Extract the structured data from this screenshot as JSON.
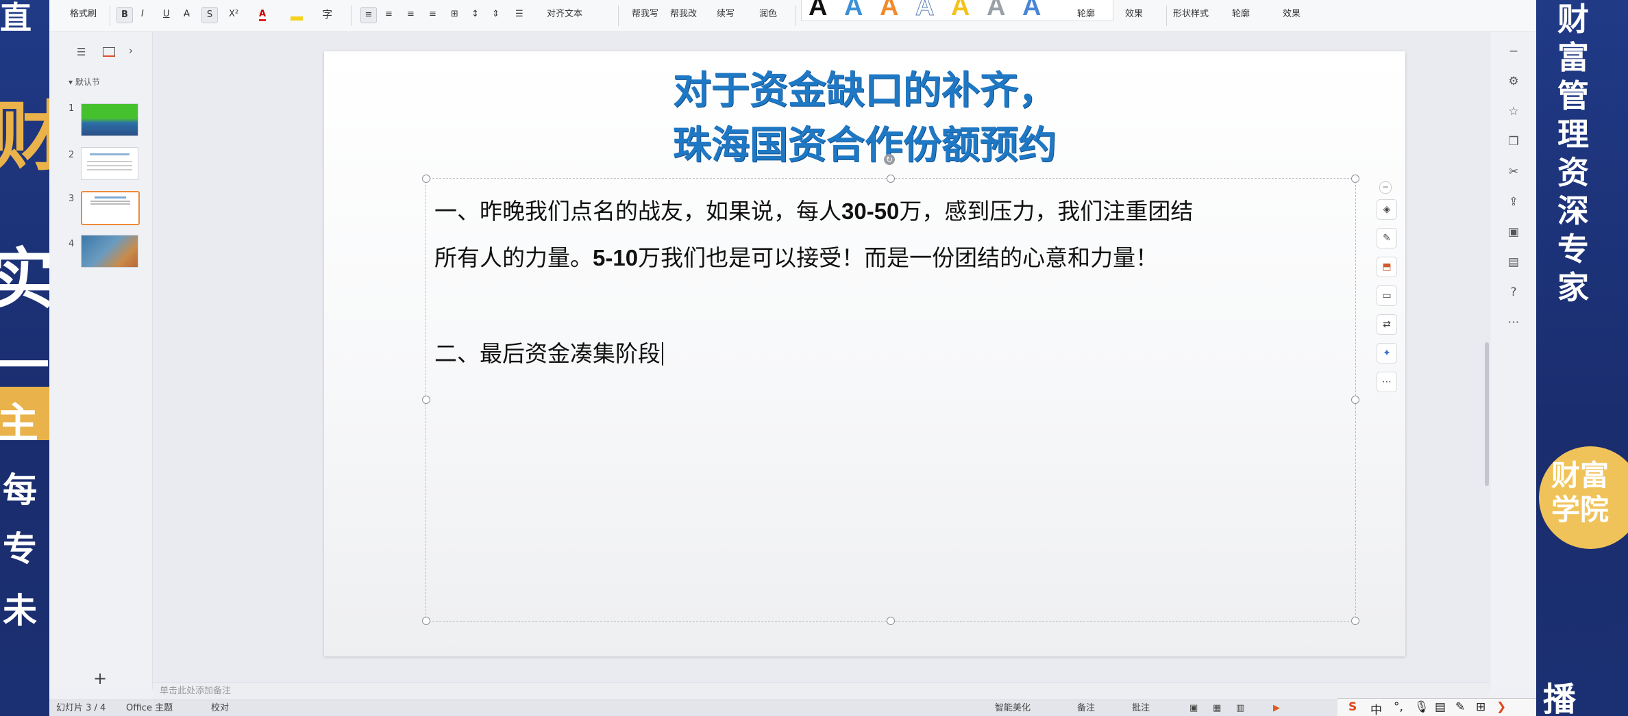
{
  "left_banner": {
    "glyphs": [
      "直",
      "财",
      "实",
      "一",
      "主",
      "每",
      "专",
      "未"
    ]
  },
  "right_banner": {
    "title_chars": [
      "财",
      "富",
      "管",
      "理",
      "资",
      "深",
      "专",
      "家"
    ],
    "academy": "财富学院",
    "bottom_text": "播"
  },
  "ribbon": {
    "format_painter": "格式刷",
    "bold": "B",
    "italic": "I",
    "underline": "U",
    "strike": "A",
    "shadow": "S",
    "superscript": "X²",
    "font_color": "A",
    "align_text": "对齐文本",
    "help_write": "帮我写",
    "help_change": "帮我改",
    "continue_write": "续写",
    "polish": "润色",
    "wordart_letter": "A",
    "outline": "轮廓",
    "effect": "效果",
    "shape_style": "形状样式",
    "outline2": "轮廓",
    "effect2": "效果"
  },
  "sidebar": {
    "section_label": "默认节",
    "slides": [
      {
        "num": "1"
      },
      {
        "num": "2"
      },
      {
        "num": "3"
      },
      {
        "num": "4"
      }
    ],
    "add_label": "+"
  },
  "slide": {
    "title_line1": "对于资金缺口的补齐，",
    "title_line2": "珠海国资合作份额预约",
    "para1_a": "一、昨晚我们点名的战友，如果说，每人",
    "para1_b": "30-50",
    "para1_c": "万，感到压力，我们注重团结",
    "para1_d": "所有人的力量。",
    "para1_e": "5-10",
    "para1_f": "万我们也是可以接受！而是一份团结的心意和力量！",
    "para2": "二、最后资金凑集阶段"
  },
  "notes_placeholder": "单击此处添加备注",
  "status": {
    "slide_counter": "幻灯片 3 / 4",
    "theme": "Office 主题",
    "proofing": "校对",
    "smart_beautify": "智能美化",
    "notes_btn": "备注",
    "comments_btn": "批注"
  },
  "ime": {
    "lang": "中"
  },
  "colors": {
    "title_blue": "#1f78c4",
    "accent_orange": "#ee8a3a",
    "banner_navy": "#1e2f6b",
    "gold": "#f0c35a"
  }
}
